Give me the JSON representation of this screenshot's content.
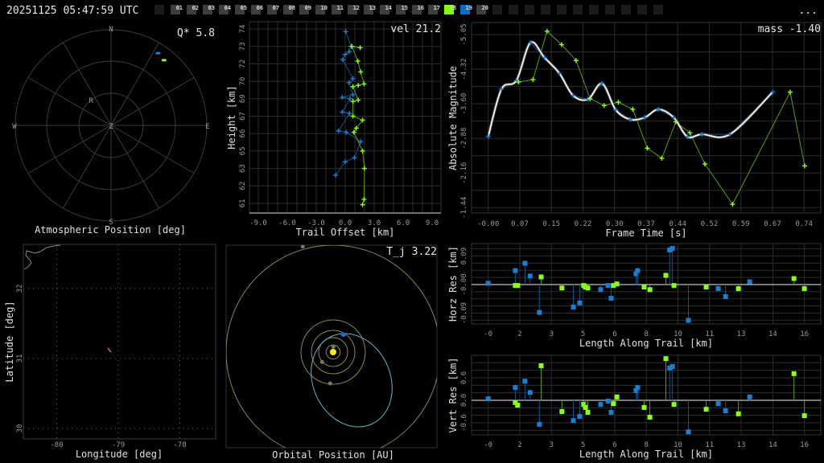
{
  "header": {
    "timestamp": "20251125 05:47:59 UTC",
    "menu": "...",
    "frames": [
      {
        "label": "",
        "state": "empty"
      },
      {
        "label": "01",
        "state": "normal"
      },
      {
        "label": "02",
        "state": "normal"
      },
      {
        "label": "03",
        "state": "normal"
      },
      {
        "label": "04",
        "state": "normal"
      },
      {
        "label": "05",
        "state": "normal"
      },
      {
        "label": "06",
        "state": "normal"
      },
      {
        "label": "07",
        "state": "normal"
      },
      {
        "label": "08",
        "state": "normal"
      },
      {
        "label": "09",
        "state": "normal"
      },
      {
        "label": "10",
        "state": "normal"
      },
      {
        "label": "11",
        "state": "normal"
      },
      {
        "label": "12",
        "state": "normal"
      },
      {
        "label": "13",
        "state": "normal"
      },
      {
        "label": "14",
        "state": "normal"
      },
      {
        "label": "15",
        "state": "normal"
      },
      {
        "label": "16",
        "state": "normal"
      },
      {
        "label": "17",
        "state": "normal"
      },
      {
        "label": "18",
        "state": "green"
      },
      {
        "label": "19",
        "state": "blue"
      },
      {
        "label": "20",
        "state": "normal"
      },
      {
        "label": "",
        "state": "empty"
      },
      {
        "label": "",
        "state": "empty"
      },
      {
        "label": "",
        "state": "empty"
      },
      {
        "label": "",
        "state": "empty"
      },
      {
        "label": "",
        "state": "empty"
      },
      {
        "label": "",
        "state": "empty"
      },
      {
        "label": "",
        "state": "empty"
      },
      {
        "label": "",
        "state": "empty"
      },
      {
        "label": "",
        "state": "empty"
      },
      {
        "label": "",
        "state": "empty"
      },
      {
        "label": "",
        "state": "empty"
      }
    ]
  },
  "colors": {
    "station_a": "#1a7fd0",
    "station_b": "#8cff1a",
    "stem_a": "#0d5688",
    "stem_b": "#5c9c12",
    "fit": "#ffffff",
    "trail": "#ff7f2a",
    "orbit": "#5fb4c6",
    "planet_orbit": "#8a8a4c",
    "sun": "#ffee00"
  },
  "polar": {
    "title": "Atmospheric Position [deg]",
    "metric": "Q*  5.8",
    "compass": {
      "n": "N",
      "s": "S",
      "e": "E",
      "w": "W",
      "z": "Z"
    },
    "radiant": {
      "label": "R",
      "az": 321,
      "el": 60
    },
    "stations": [
      {
        "az": 33,
        "el": 9,
        "color": "station_a"
      },
      {
        "az": 39,
        "el": 11,
        "color": "station_b"
      }
    ]
  },
  "chart_data": [
    {
      "type": "scatter",
      "id": "height",
      "title": "vel 21.2",
      "xlabel": "Trail Offset [km]",
      "ylabel": "Height [km]",
      "xlim": [
        -9,
        9
      ],
      "ylim": [
        61,
        74
      ],
      "xticks": [
        "-9.0",
        "-6.0",
        "-3.0",
        "0.0",
        "3.0",
        "6.0",
        "9.0"
      ],
      "yticks": [
        "74",
        "73",
        "72",
        "70",
        "69",
        "67",
        "66",
        "65",
        "63",
        "62",
        "61"
      ],
      "series": [
        {
          "name": "station_a",
          "points": [
            [
              0.05,
              73.8
            ],
            [
              0.6,
              72.7
            ],
            [
              0.4,
              72.3
            ],
            [
              0.0,
              72.1
            ],
            [
              -0.25,
              71.7
            ],
            [
              0.8,
              70.3
            ],
            [
              0.4,
              70.0
            ],
            [
              0.8,
              69.1
            ],
            [
              -0.3,
              68.9
            ],
            [
              0.5,
              68.8
            ],
            [
              -0.3,
              67.8
            ],
            [
              0.45,
              67.7
            ],
            [
              -0.7,
              66.4
            ],
            [
              0.1,
              66.3
            ],
            [
              1.6,
              65.6
            ],
            [
              0.95,
              64.4
            ],
            [
              0.0,
              64.1
            ],
            [
              -1.0,
              63.1
            ]
          ]
        },
        {
          "name": "station_b",
          "points": [
            [
              1.55,
              72.6
            ],
            [
              0.7,
              72.7
            ],
            [
              1.3,
              71.6
            ],
            [
              1.6,
              70.8
            ],
            [
              1.95,
              69.9
            ],
            [
              1.35,
              69.8
            ],
            [
              0.8,
              69.7
            ],
            [
              1.35,
              68.7
            ],
            [
              0.8,
              68.6
            ],
            [
              0.8,
              67.5
            ],
            [
              1.8,
              67.2
            ],
            [
              1.15,
              66.6
            ],
            [
              0.9,
              66.3
            ],
            [
              1.8,
              64.9
            ],
            [
              2.0,
              63.6
            ],
            [
              1.95,
              61.3
            ],
            [
              1.8,
              60.9
            ]
          ]
        }
      ]
    },
    {
      "type": "line",
      "id": "magnitude",
      "title": "mass -1.40",
      "xlabel": "Frame Time [s]",
      "ylabel": "Absolute Magnitude",
      "xlim": [
        0,
        0.74
      ],
      "ylim": [
        -5.05,
        -1.44
      ],
      "xticks": [
        "-0.00",
        "0.07",
        "0.15",
        "0.22",
        "0.30",
        "0.37",
        "0.44",
        "0.52",
        "0.59",
        "0.67",
        "0.74"
      ],
      "yticks": [
        "-5.05",
        "-4.32",
        "-3.60",
        "-2.88",
        "-2.16",
        "-1.44"
      ],
      "series": [
        {
          "name": "station_a",
          "points": [
            [
              0,
              -2.92
            ],
            [
              0.031,
              -3.91
            ],
            [
              0.066,
              -4.09
            ],
            [
              0.099,
              -4.88
            ],
            [
              0.132,
              -4.57
            ],
            [
              0.167,
              -4.24
            ],
            [
              0.199,
              -3.78
            ],
            [
              0.234,
              -3.7
            ],
            [
              0.267,
              -4.03
            ],
            [
              0.299,
              -3.48
            ],
            [
              0.333,
              -3.28
            ],
            [
              0.367,
              -3.32
            ],
            [
              0.399,
              -3.49
            ],
            [
              0.435,
              -3.32
            ],
            [
              0.467,
              -2.92
            ],
            [
              0.501,
              -2.97
            ],
            [
              0.567,
              -2.97
            ],
            [
              0.667,
              -3.85
            ]
          ]
        },
        {
          "name": "station_b",
          "points": [
            [
              0.071,
              -4.06
            ],
            [
              0.105,
              -4.11
            ],
            [
              0.138,
              -5.12
            ],
            [
              0.172,
              -4.84
            ],
            [
              0.206,
              -4.51
            ],
            [
              0.239,
              -3.71
            ],
            [
              0.272,
              -3.57
            ],
            [
              0.305,
              -3.64
            ],
            [
              0.339,
              -3.49
            ],
            [
              0.373,
              -2.68
            ],
            [
              0.407,
              -2.47
            ],
            [
              0.44,
              -3.23
            ],
            [
              0.473,
              -3.0
            ],
            [
              0.508,
              -2.35
            ],
            [
              0.573,
              -1.51
            ],
            [
              0.708,
              -3.85
            ],
            [
              0.742,
              -2.31
            ]
          ]
        }
      ]
    },
    {
      "type": "scatter",
      "id": "horz_res",
      "xlabel": "Length Along Trail [km]",
      "ylabel": "Horz Res [km]",
      "xlim": [
        0,
        16
      ],
      "xticks": [
        "-0",
        "2",
        "3",
        "5",
        "6",
        "8",
        "10",
        "11",
        "13",
        "14",
        "16"
      ],
      "yticks": [
        "0.09",
        "-0.00",
        "-0.09"
      ],
      "series": [
        {
          "name": "station_a",
          "points": [
            [
              0,
              0.004
            ],
            [
              1.37,
              0.044
            ],
            [
              1.86,
              0.067
            ],
            [
              2.12,
              0.027
            ],
            [
              2.59,
              -0.088
            ],
            [
              4.31,
              -0.071
            ],
            [
              4.63,
              -0.058
            ],
            [
              5.69,
              -0.016
            ],
            [
              6.06,
              -0.003
            ],
            [
              6.22,
              -0.043
            ],
            [
              7.48,
              0.034
            ],
            [
              7.56,
              0.044
            ],
            [
              9.18,
              0.109
            ],
            [
              9.32,
              0.114
            ],
            [
              10.13,
              -0.113
            ],
            [
              11.64,
              -0.013
            ],
            [
              12.01,
              -0.038
            ],
            [
              13.23,
              0.009
            ]
          ]
        },
        {
          "name": "station_b",
          "points": [
            [
              1.37,
              -0.003
            ],
            [
              1.49,
              -0.003
            ],
            [
              2.68,
              0.024
            ],
            [
              3.73,
              -0.011
            ],
            [
              4.83,
              -0.003
            ],
            [
              4.92,
              -0.008
            ],
            [
              5.04,
              -0.011
            ],
            [
              6.34,
              -0.003
            ],
            [
              6.51,
              0.002
            ],
            [
              7.89,
              -0.008
            ],
            [
              8.18,
              -0.016
            ],
            [
              8.99,
              0.029
            ],
            [
              9.4,
              -0.003
            ],
            [
              11.03,
              -0.008
            ],
            [
              12.66,
              -0.013
            ],
            [
              15.47,
              0.019
            ],
            [
              16.0,
              -0.013
            ]
          ]
        }
      ]
    },
    {
      "type": "scatter",
      "id": "vert_res",
      "xlabel": "Length Along Trail [km]",
      "ylabel": "Vert Res [km]",
      "xlim": [
        0,
        16
      ],
      "xticks": [
        "-0",
        "2",
        "3",
        "5",
        "6",
        "8",
        "10",
        "11",
        "13",
        "14",
        "16"
      ],
      "yticks": [
        "0.6",
        "0.0",
        "-0.6"
      ],
      "series": [
        {
          "name": "station_a",
          "points": [
            [
              0,
              0.04
            ],
            [
              1.37,
              0.34
            ],
            [
              1.86,
              0.51
            ],
            [
              2.12,
              0.21
            ],
            [
              2.59,
              -0.64
            ],
            [
              4.31,
              -0.54
            ],
            [
              4.63,
              -0.43
            ],
            [
              5.69,
              -0.11
            ],
            [
              6.06,
              -0.02
            ],
            [
              6.22,
              -0.32
            ],
            [
              7.48,
              0.26
            ],
            [
              7.56,
              0.34
            ],
            [
              9.18,
              0.86
            ],
            [
              9.32,
              0.9
            ],
            [
              10.13,
              -0.84
            ],
            [
              11.64,
              -0.09
            ],
            [
              12.01,
              -0.28
            ],
            [
              13.23,
              0.09
            ]
          ]
        },
        {
          "name": "station_b",
          "points": [
            [
              1.37,
              -0.06
            ],
            [
              1.49,
              -0.13
            ],
            [
              2.68,
              0.92
            ],
            [
              3.73,
              -0.3
            ],
            [
              4.83,
              -0.11
            ],
            [
              4.92,
              -0.19
            ],
            [
              5.04,
              -0.32
            ],
            [
              6.34,
              -0.09
            ],
            [
              6.51,
              0.09
            ],
            [
              7.89,
              -0.19
            ],
            [
              8.18,
              -0.45
            ],
            [
              8.99,
              1.11
            ],
            [
              9.4,
              -0.11
            ],
            [
              11.03,
              -0.24
            ],
            [
              12.66,
              -0.36
            ],
            [
              15.47,
              0.71
            ],
            [
              16.0,
              -0.41
            ]
          ]
        }
      ]
    }
  ],
  "map": {
    "xlabel": "Longitude [deg]",
    "ylabel": "Latitude [deg]",
    "xticks": [
      {
        "label": "-80",
        "v": -80
      },
      {
        "label": "-79",
        "v": -79
      },
      {
        "label": "-78",
        "v": -78
      }
    ],
    "yticks": [
      {
        "label": "32",
        "v": 32
      },
      {
        "label": "31",
        "v": 31
      },
      {
        "label": "30",
        "v": 30
      }
    ],
    "trail": [
      [
        -79.17,
        31.15
      ],
      [
        -79.12,
        31.09
      ]
    ]
  },
  "orbit": {
    "title": "Orbital Position [AU]",
    "metric": "T_j 3.22"
  }
}
